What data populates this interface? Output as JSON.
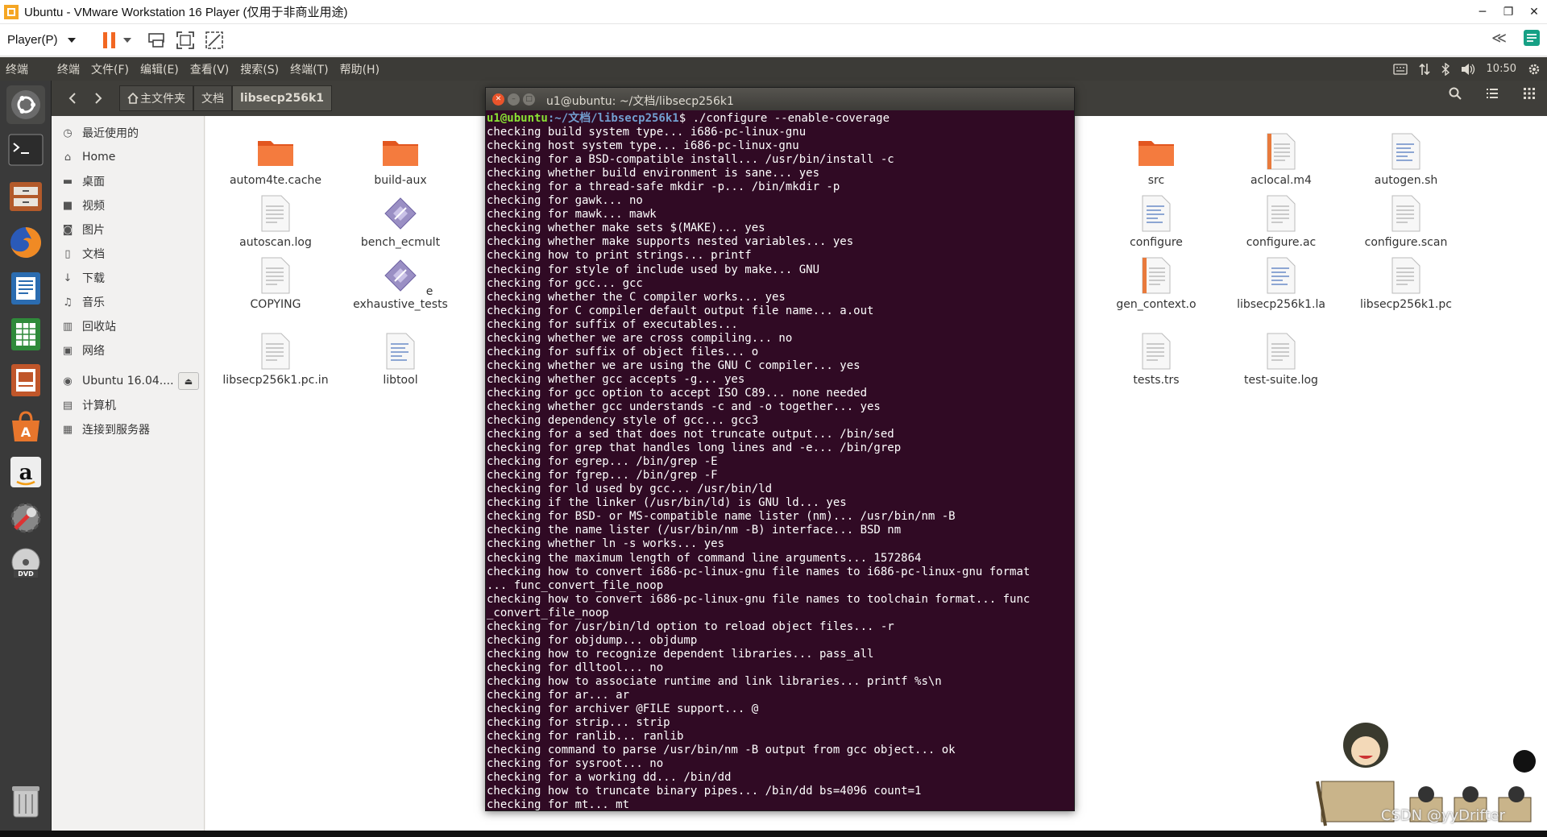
{
  "vm": {
    "title": "Ubuntu - VMware Workstation 16 Player (仅用于非商业用途)",
    "player_menu": "Player(P)",
    "controls": {
      "minimize": "─",
      "restore": "❐",
      "close": "✕"
    },
    "collapse": "≪"
  },
  "ubuntu_panel": {
    "app_name": "终端",
    "menus": [
      "终端",
      "文件(F)",
      "编辑(E)",
      "查看(V)",
      "搜索(S)",
      "终端(T)",
      "帮助(H)"
    ],
    "time": "10:50"
  },
  "file_manager": {
    "breadcrumbs": [
      "主文件夹",
      "文档",
      "libsecp256k1"
    ],
    "sidebar": [
      {
        "icon": "clock-icon",
        "label": "最近使用的"
      },
      {
        "icon": "home-icon",
        "label": "Home"
      },
      {
        "icon": "desktop-icon",
        "label": "桌面"
      },
      {
        "icon": "video-icon",
        "label": "视频"
      },
      {
        "icon": "camera-icon",
        "label": "图片"
      },
      {
        "icon": "document-icon",
        "label": "文档"
      },
      {
        "icon": "download-icon",
        "label": "下载"
      },
      {
        "icon": "music-icon",
        "label": "音乐"
      },
      {
        "icon": "trash-icon",
        "label": "回收站"
      },
      {
        "icon": "network-icon",
        "label": "网络"
      }
    ],
    "devices": [
      {
        "icon": "disk-icon",
        "label": "Ubuntu 16.04...."
      },
      {
        "icon": "computer-icon",
        "label": "计算机"
      },
      {
        "icon": "server-icon",
        "label": "连接到服务器"
      }
    ],
    "files": [
      {
        "name": "autom4te.cache",
        "type": "folder"
      },
      {
        "name": "build-aux",
        "type": "folder"
      },
      {
        "name": "src",
        "type": "folder"
      },
      {
        "name": "aclocal.m4",
        "type": "text-orange"
      },
      {
        "name": "autogen.sh",
        "type": "script"
      },
      {
        "name": "autoscan.log",
        "type": "text"
      },
      {
        "name": "bench_ecmult",
        "type": "binary"
      },
      {
        "name": "configure",
        "type": "script"
      },
      {
        "name": "configure.ac",
        "type": "text"
      },
      {
        "name": "configure.scan",
        "type": "text"
      },
      {
        "name": "COPYING",
        "type": "text"
      },
      {
        "name": "exhaustive_tests",
        "type": "binary"
      },
      {
        "name": "gen_context.o",
        "type": "text-orange"
      },
      {
        "name": "libsecp256k1.la",
        "type": "script"
      },
      {
        "name": "libsecp256k1.pc",
        "type": "text"
      },
      {
        "name": "libsecp256k1.pc.in",
        "type": "text"
      },
      {
        "name": "libtool",
        "type": "script"
      },
      {
        "name": "tests.trs",
        "type": "text"
      },
      {
        "name": "test-suite.log",
        "type": "text"
      }
    ],
    "partial_label": "e"
  },
  "terminal": {
    "title": "u1@ubuntu: ~/文档/libsecp256k1",
    "prompt_user": "u1@ubuntu",
    "prompt_path": ":~/文档/libsecp256k1",
    "prompt_command": "$ ./configure --enable-coverage",
    "lines": [
      "checking build system type... i686-pc-linux-gnu",
      "checking host system type... i686-pc-linux-gnu",
      "checking for a BSD-compatible install... /usr/bin/install -c",
      "checking whether build environment is sane... yes",
      "checking for a thread-safe mkdir -p... /bin/mkdir -p",
      "checking for gawk... no",
      "checking for mawk... mawk",
      "checking whether make sets $(MAKE)... yes",
      "checking whether make supports nested variables... yes",
      "checking how to print strings... printf",
      "checking for style of include used by make... GNU",
      "checking for gcc... gcc",
      "checking whether the C compiler works... yes",
      "checking for C compiler default output file name... a.out",
      "checking for suffix of executables...",
      "checking whether we are cross compiling... no",
      "checking for suffix of object files... o",
      "checking whether we are using the GNU C compiler... yes",
      "checking whether gcc accepts -g... yes",
      "checking for gcc option to accept ISO C89... none needed",
      "checking whether gcc understands -c and -o together... yes",
      "checking dependency style of gcc... gcc3",
      "checking for a sed that does not truncate output... /bin/sed",
      "checking for grep that handles long lines and -e... /bin/grep",
      "checking for egrep... /bin/grep -E",
      "checking for fgrep... /bin/grep -F",
      "checking for ld used by gcc... /usr/bin/ld",
      "checking if the linker (/usr/bin/ld) is GNU ld... yes",
      "checking for BSD- or MS-compatible name lister (nm)... /usr/bin/nm -B",
      "checking the name lister (/usr/bin/nm -B) interface... BSD nm",
      "checking whether ln -s works... yes",
      "checking the maximum length of command line arguments... 1572864",
      "checking how to convert i686-pc-linux-gnu file names to i686-pc-linux-gnu format",
      "... func_convert_file_noop",
      "checking how to convert i686-pc-linux-gnu file names to toolchain format... func",
      "_convert_file_noop",
      "checking for /usr/bin/ld option to reload object files... -r",
      "checking for objdump... objdump",
      "checking how to recognize dependent libraries... pass_all",
      "checking for dlltool... no",
      "checking how to associate runtime and link libraries... printf %s\\n",
      "checking for ar... ar",
      "checking for archiver @FILE support... @",
      "checking for strip... strip",
      "checking for ranlib... ranlib",
      "checking command to parse /usr/bin/nm -B output from gcc object... ok",
      "checking for sysroot... no",
      "checking for a working dd... /bin/dd",
      "checking how to truncate binary pipes... /bin/dd bs=4096 count=1",
      "checking for mt... mt"
    ]
  },
  "watermark": "CSDN @yyDrifter"
}
